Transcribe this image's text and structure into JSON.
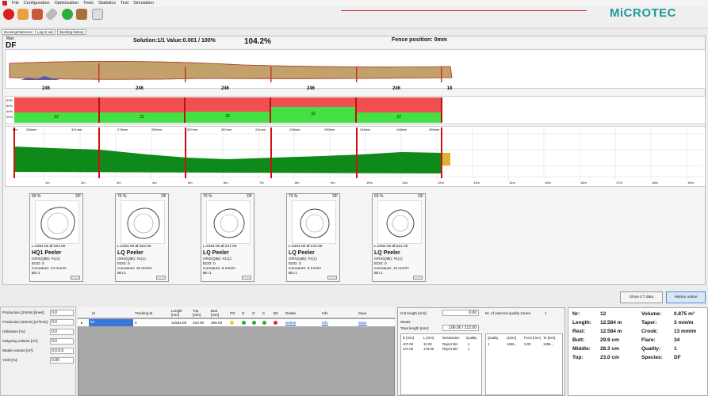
{
  "menu": [
    "File",
    "Configuration",
    "Optimization",
    "Tools",
    "Statistics",
    "Test",
    "Simulation"
  ],
  "brand": "MiCROTEC",
  "tabs": [
    "Bucking/Optimizer",
    "Log in out",
    "Bucking history"
  ],
  "header": {
    "man": "Man",
    "species": "DF",
    "solution": "Solution:1/1  Value:0.001 / 100%",
    "percent": "104.2%",
    "fence": "Fence position: 0mm"
  },
  "segments": [
    "246",
    "246",
    "246",
    "246",
    "246",
    "18"
  ],
  "grade_axis": [
    "80%",
    "60%",
    "40%",
    "20%"
  ],
  "grade_values": [
    "22",
    "22",
    "25",
    "32",
    "22"
  ],
  "diameter_labels": [
    "Min",
    "266mm",
    "301mm",
    "278mm",
    "269mm",
    "267mm",
    "267mm",
    "241mm",
    "248mm",
    "250mm",
    "248mm",
    "248mm",
    "266mm"
  ],
  "length_axis": [
    "1m",
    "2m",
    "3m",
    "4m",
    "5m",
    "6m",
    "7m",
    "8m",
    "9m",
    "10m",
    "11m",
    "12m",
    "13m",
    "14m",
    "15m",
    "16m",
    "17m",
    "18m",
    "19m"
  ],
  "cards": [
    {
      "pct": "69 %",
      "sp": "DF",
      "l1": "L:2464.00 Ø:294.00",
      "title": "HQ1 Peeler",
      "d1": "GRX(QIB): #1(1)",
      "d2": "EDO: 0",
      "d3": "Curvature: 14 mm/m",
      "d4": "Bin:1"
    },
    {
      "pct": "70 %",
      "sp": "DF",
      "l1": "L:2464.00 Ø:263.00",
      "title": "LQ Peeler",
      "d1": "GRX(QIB): #1(1)",
      "d2": "EDO: 0",
      "d3": "Curvature: 10 mm/m",
      "d4": "Bin:1"
    },
    {
      "pct": "70 %",
      "sp": "DF",
      "l1": "L:2464.00 Ø:247.00",
      "title": "LQ Peeler",
      "d1": "GRX(QIB): #1(1)",
      "d2": "EDO: 0",
      "d3": "Curvature: 8 mm/m",
      "d4": "Bin:1"
    },
    {
      "pct": "73 %",
      "sp": "DF",
      "l1": "L:2464.00 Ø:243.00",
      "title": "LQ Peeler",
      "d1": "GRX(QIB): #1(1)",
      "d2": "EDO: 0",
      "d3": "Curvature: 8 mm/m",
      "d4": "Bin:1"
    },
    {
      "pct": "63 %",
      "sp": "DF",
      "l1": "L:2464.00 Ø:221.00",
      "title": "LQ Peeler",
      "d1": "GRX(QIB): #1(1)",
      "d2": "EDO: 0",
      "d3": "Curvature: 13 mm/m",
      "d4": "Bin:1"
    }
  ],
  "buttons": {
    "ct": "Show CT data",
    "history": "History online"
  },
  "production": [
    {
      "label": "Production (20min) [lines]:",
      "value": "0.0"
    },
    {
      "label": "Production (20min) [m³/min]:",
      "value": "0.0"
    },
    {
      "label": "Utilization [%]:",
      "value": "0.0"
    },
    {
      "label": "Outgoing volume [m³]:",
      "value": "0.0"
    },
    {
      "label": "Waste volume [m³]:",
      "value": "0.0.0.0"
    },
    {
      "label": "Yield [%]:",
      "value": "0.00"
    }
  ],
  "table": {
    "headers": [
      "Id",
      "Tracking Id",
      "Length [mm]",
      "Top [mm]",
      "Butt [mm]",
      "PO",
      "G",
      "O",
      "C",
      "BC",
      "Delete",
      "Info",
      "Save"
    ],
    "row": {
      "id": "92",
      "tracking": "0",
      "length": "12584.00",
      "top": "229.00",
      "butt": "299.00",
      "delete": "Delete",
      "info": "Info",
      "save": "Save"
    }
  },
  "cut": {
    "cut_length_label": "Cut length [mm]:",
    "cut_length": "0.00",
    "waste_label": "Waste",
    "total_label": "Total length [mm]:",
    "total": "106.00 / 212.00",
    "ext_label": "Nr. of external quality zones:",
    "ext": "1",
    "headers": [
      "D [mm]",
      "L [mm]",
      "Destination",
      "Quality"
    ],
    "rows": [
      [
        "407.00",
        "10.00",
        "Reject Bin",
        "1"
      ],
      [
        "374.00",
        "176.00",
        "Reject Bin",
        "1"
      ]
    ],
    "qheaders": [
      "Quality",
      "L[mm]",
      "From [mm]",
      "To [mm]"
    ],
    "qrows": [
      [
        "1",
        "1256...",
        "0.00",
        "1256..."
      ]
    ]
  },
  "stats_left": [
    [
      "Nr:",
      "12"
    ],
    [
      "Length:",
      "12.584 m"
    ],
    [
      "Rest:",
      "12.584 m"
    ],
    [
      "Butt:",
      "29.9 cm"
    ],
    [
      "Middle:",
      "28.3 cm"
    ],
    [
      "Top:",
      "23.0 cm"
    ]
  ],
  "stats_right": [
    [
      "Volume:",
      "0.875 m³"
    ],
    [
      "Taper:",
      "3 mm/m"
    ],
    [
      "Crook:",
      "13 mm/m"
    ],
    [
      "Flare:",
      "34"
    ],
    [
      "Quality:",
      "1"
    ],
    [
      "Species:",
      "DF"
    ]
  ],
  "colors": {
    "red": "#f05050",
    "green": "#44e044",
    "dark_green": "#0e8a1a",
    "brand": "#1e9a98",
    "cut_line": "#d01010"
  }
}
